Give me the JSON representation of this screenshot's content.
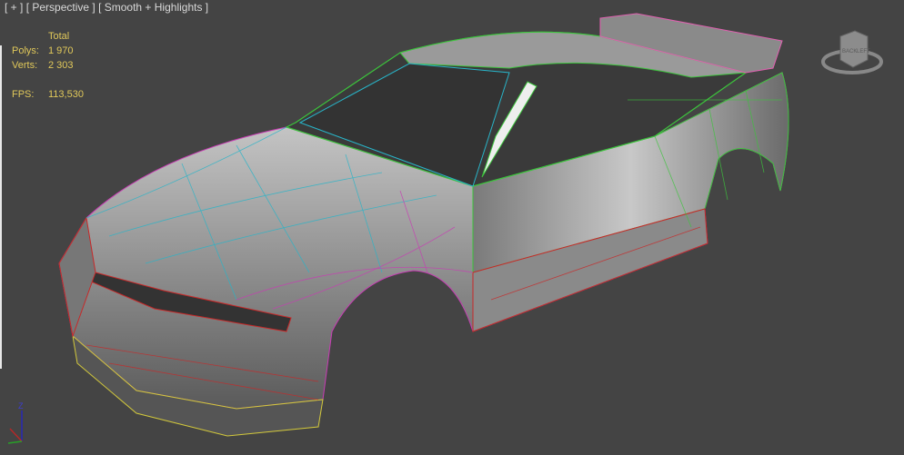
{
  "viewport": {
    "menu_plus": "[ + ]",
    "view_mode": "[ Perspective ]",
    "shading_mode": "[ Smooth + Highlights ]"
  },
  "stats": {
    "header": "Total",
    "polys_label": "Polys:",
    "polys_value": "1 970",
    "verts_label": "Verts:",
    "verts_value": "2 303",
    "fps_label": "FPS:",
    "fps_value": "113,530"
  },
  "viewcube": {
    "back": "BACK",
    "left": "LEFT"
  },
  "axis": {
    "z": "Z"
  },
  "colors": {
    "background": "#444444",
    "stats": "#e0c85a",
    "wire_green": "#3cc43c",
    "wire_cyan": "#28b4c8",
    "wire_magenta": "#c83cb4",
    "wire_red": "#c82828",
    "wire_yellow": "#d2c83c"
  }
}
